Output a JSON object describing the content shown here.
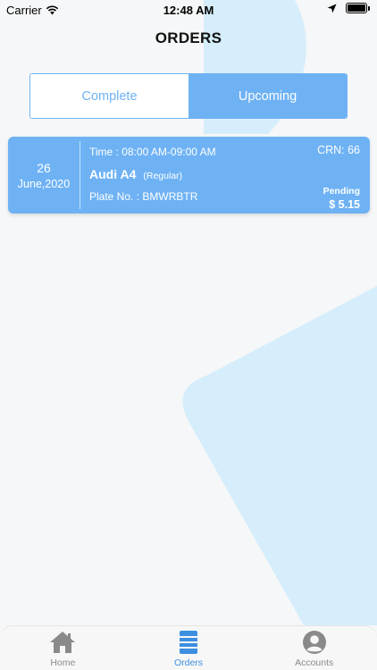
{
  "status_bar": {
    "carrier": "Carrier",
    "time": "12:48 AM"
  },
  "header": {
    "title": "ORDERS"
  },
  "segment": {
    "tabs": [
      {
        "label": "Complete",
        "selected": false
      },
      {
        "label": "Upcoming",
        "selected": true
      }
    ]
  },
  "orders": [
    {
      "day": "26",
      "month_year": "June,2020",
      "time_slot": "Time : 08:00 AM-09:00 AM",
      "car_name": "Audi A4",
      "car_type": "(Regular)",
      "plate": "Plate No. : BMWRBTR",
      "crn": "CRN: 66",
      "status": "Pending",
      "price": "$ 5.15"
    }
  ],
  "tab_bar": {
    "items": [
      {
        "label": "Home",
        "icon": "home-icon",
        "active": false
      },
      {
        "label": "Orders",
        "icon": "orders-icon",
        "active": true
      },
      {
        "label": "Accounts",
        "icon": "account-icon",
        "active": false
      }
    ]
  },
  "colors": {
    "accent": "#6eb2f4",
    "background_shape": "#d6eefb",
    "active_tab": "#3d8fe0",
    "inactive_tab": "#8a8a8a"
  }
}
